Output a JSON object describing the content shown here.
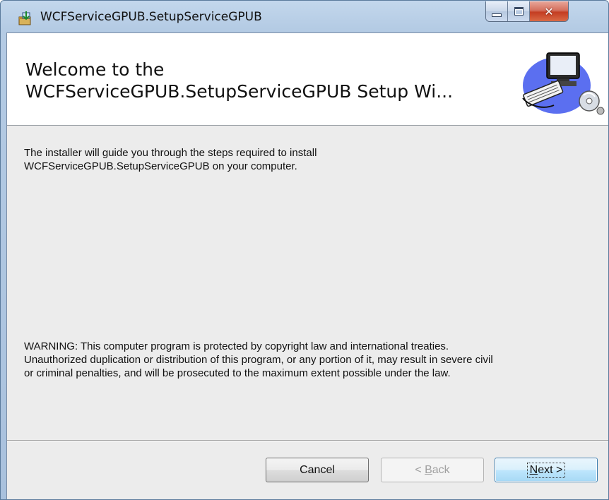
{
  "window": {
    "title": "WCFServiceGPUB.SetupServiceGPUB",
    "icon": "installer-icon",
    "controls": {
      "minimize": "minimize-icon",
      "maximize": "maximize-icon",
      "close": "close-icon"
    }
  },
  "banner": {
    "title_line1": "Welcome to the",
    "title_line2": "WCFServiceGPUB.SetupServiceGPUB Setup Wi...",
    "art": "computer-setup-illustration"
  },
  "body": {
    "intro_line1": "The installer will guide you through the steps required to install",
    "intro_line2": "WCFServiceGPUB.SetupServiceGPUB on your computer.",
    "warning_line1": "WARNING: This computer program is protected by copyright law and international treaties.",
    "warning_line2": "Unauthorized duplication or distribution of this program, or any portion of it, may result in severe civil",
    "warning_line3": "or criminal penalties, and will be prosecuted to the maximum extent possible under the law."
  },
  "buttons": {
    "cancel": "Cancel",
    "back_prefix": "< ",
    "back_key": "B",
    "back_rest": "ack",
    "next_key": "N",
    "next_rest": "ext >"
  },
  "colors": {
    "frame": "#b4cbe4",
    "client": "#ececec",
    "close_button": "#c43d22"
  }
}
